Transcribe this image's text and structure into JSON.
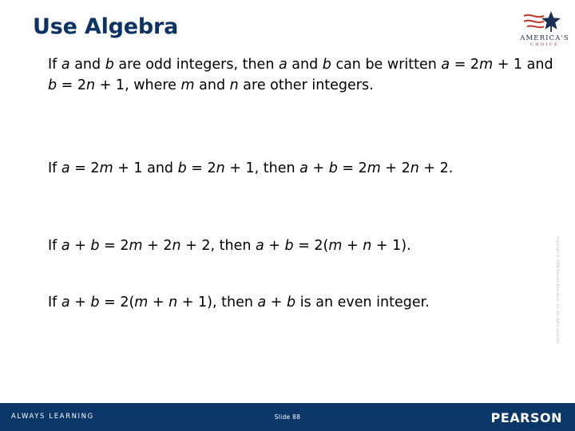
{
  "slide": {
    "title": "Use Algebra",
    "paragraphs": [
      {
        "id": "p1",
        "parts": [
          {
            "t": "If ",
            "i": false
          },
          {
            "t": "a",
            "i": true
          },
          {
            "t": " and ",
            "i": false
          },
          {
            "t": "b",
            "i": true
          },
          {
            "t": " are odd integers, then ",
            "i": false
          },
          {
            "t": "a",
            "i": true
          },
          {
            "t": " and ",
            "i": false
          },
          {
            "t": "b",
            "i": true
          },
          {
            "t": " can be written ",
            "i": false
          },
          {
            "t": "a",
            "i": true
          },
          {
            "t": " = 2",
            "i": false
          },
          {
            "t": "m",
            "i": true
          },
          {
            "t": " + 1 and ",
            "i": false
          },
          {
            "t": "b",
            "i": true
          },
          {
            "t": " = 2",
            "i": false
          },
          {
            "t": "n",
            "i": true
          },
          {
            "t": " + 1, where ",
            "i": false
          },
          {
            "t": "m",
            "i": true
          },
          {
            "t": " and ",
            "i": false
          },
          {
            "t": "n",
            "i": true
          },
          {
            "t": " are other integers.",
            "i": false
          }
        ]
      },
      {
        "id": "p2",
        "parts": [
          {
            "t": "If ",
            "i": false
          },
          {
            "t": "a",
            "i": true
          },
          {
            "t": " = 2",
            "i": false
          },
          {
            "t": "m",
            "i": true
          },
          {
            "t": " + 1 and ",
            "i": false
          },
          {
            "t": "b",
            "i": true
          },
          {
            "t": " = 2",
            "i": false
          },
          {
            "t": "n",
            "i": true
          },
          {
            "t": " + 1, then ",
            "i": false
          },
          {
            "t": "a",
            "i": true
          },
          {
            "t": " + ",
            "i": false
          },
          {
            "t": "b",
            "i": true
          },
          {
            "t": "  = 2",
            "i": false
          },
          {
            "t": "m",
            "i": true
          },
          {
            "t": " + 2",
            "i": false
          },
          {
            "t": "n",
            "i": true
          },
          {
            "t": " + 2.",
            "i": false
          }
        ]
      },
      {
        "id": "p3",
        "parts": [
          {
            "t": "If ",
            "i": false
          },
          {
            "t": "a",
            "i": true
          },
          {
            "t": " + ",
            "i": false
          },
          {
            "t": "b",
            "i": true
          },
          {
            "t": " = 2",
            "i": false
          },
          {
            "t": "m",
            "i": true
          },
          {
            "t": " + 2",
            "i": false
          },
          {
            "t": "n",
            "i": true
          },
          {
            "t": " + 2, then ",
            "i": false
          },
          {
            "t": "a",
            "i": true
          },
          {
            "t": " + ",
            "i": false
          },
          {
            "t": "b",
            "i": true
          },
          {
            "t": " = 2(",
            "i": false
          },
          {
            "t": "m",
            "i": true
          },
          {
            "t": " + ",
            "i": false
          },
          {
            "t": "n",
            "i": true
          },
          {
            "t": " + 1).",
            "i": false
          }
        ]
      },
      {
        "id": "p4",
        "parts": [
          {
            "t": "If ",
            "i": false
          },
          {
            "t": "a",
            "i": true
          },
          {
            "t": " + ",
            "i": false
          },
          {
            "t": "b",
            "i": true
          },
          {
            "t": " = 2(",
            "i": false
          },
          {
            "t": "m",
            "i": true
          },
          {
            "t": " + ",
            "i": false
          },
          {
            "t": "n",
            "i": true
          },
          {
            "t": " + 1), then ",
            "i": false
          },
          {
            "t": "a",
            "i": true
          },
          {
            "t": " + ",
            "i": false
          },
          {
            "t": "b",
            "i": true
          },
          {
            "t": " is an even integer.",
            "i": false
          }
        ]
      }
    ],
    "vertical_copyright": "Copyright © 2009 Pearson Education, Inc. All rights reserved.",
    "logo": {
      "name": "AMERICA'S",
      "tagline": "CHOICE",
      "icon": "americas-choice-flag-star-logo"
    },
    "footer": {
      "tagline": "ALWAYS LEARNING",
      "slide_label": "Slide 88",
      "brand": "PEARSON"
    }
  },
  "colors": {
    "title": "#0d3264",
    "footer_bar": "#0b3668",
    "logo_red": "#9b2335",
    "logo_navy": "#1b2f56",
    "body_text": "#000000",
    "page_background": "#ffffff"
  }
}
